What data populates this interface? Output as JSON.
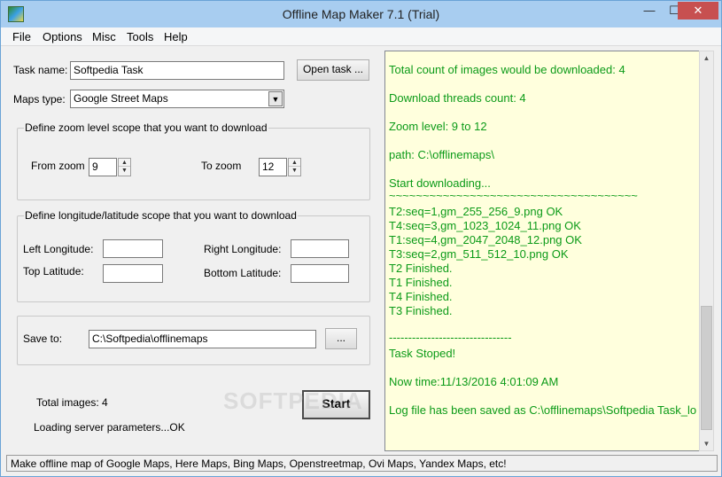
{
  "window": {
    "title": "Offline Map Maker 7.1 (Trial)",
    "controls": {
      "minimize": "—",
      "maximize": "☐",
      "close": "✕"
    }
  },
  "menu": [
    "File",
    "Options",
    "Misc",
    "Tools",
    "Help"
  ],
  "task": {
    "name_label": "Task name:",
    "name_value": "Softpedia Task",
    "open_button": "Open task ...",
    "maps_type_label": "Maps type:",
    "maps_type_value": "Google Street Maps"
  },
  "zoom": {
    "group_title": "Define zoom level scope that you want to download",
    "from_label": "From zoom",
    "from_value": "9",
    "to_label": "To zoom",
    "to_value": "12"
  },
  "coords": {
    "group_title": "Define longitude/latitude scope that you want to download",
    "left_longitude_label": "Left Longitude:",
    "right_longitude_label": "Right Longitude:",
    "top_latitude_label": "Top Latitude:",
    "bottom_latitude_label": "Bottom Latitude:"
  },
  "save": {
    "label": "Save to:",
    "path": "C:\\Softpedia\\offlinemaps",
    "browse_button": "..."
  },
  "info": {
    "total_images": "Total images: 4",
    "loading": "Loading server parameters...OK",
    "start_button": "Start"
  },
  "log": [
    "Total count of images would be downloaded: 4",
    "Download threads count: 4",
    "Zoom level: 9 to 12",
    "path: C:\\offlinemaps\\",
    "Start downloading...",
    "~~~~~~~~~~~~~~~~~~~~~~~~~~~~~~~~~~~~~",
    "T2:seq=1,gm_255_256_9.png OK",
    "T4:seq=3,gm_1023_1024_11.png OK",
    "T1:seq=4,gm_2047_2048_12.png OK",
    "T3:seq=2,gm_511_512_10.png OK",
    "T2 Finished.",
    "T1 Finished.",
    "T4 Finished.",
    "T3 Finished.",
    "--------------------------------",
    "Task Stoped!",
    "Now time:11/13/2016 4:01:09 AM",
    "Log file has been saved as C:\\offlinemaps\\Softpedia Task_lo"
  ],
  "status": "Make offline map of Google Maps, Here Maps, Bing Maps, Openstreetmap, Ovi Maps, Yandex Maps,  etc!",
  "watermark": "SOFTPEDIA"
}
